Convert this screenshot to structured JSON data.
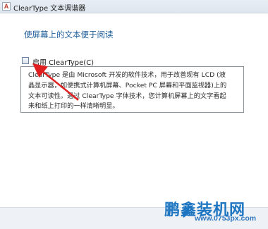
{
  "window": {
    "title": "ClearType 文本调谐器",
    "icon": "cleartype-app-icon"
  },
  "main": {
    "heading": "使屏幕上的文本便于阅读",
    "checkbox": {
      "label": "启用 ClearType(C)",
      "checked": false
    },
    "description_lines": [
      "ClearType 是由 Microsoft 开发的软件技术，用于改善现有 LCD (液",
      "晶显示器，如便携式计算机屏幕、Pocket PC 屏幕和平面监视器)上的",
      "文本可读性。通过 ClearType 字体技术，您计算机屏幕上的文字看起",
      "来和纸上打印的一样清晰明显。"
    ]
  },
  "annotation": {
    "arrow_color": "#e02020"
  },
  "watermark": {
    "logo_text": "鹏鑫装机网",
    "url": "www.0753px.com",
    "color": "#1e76c2"
  }
}
